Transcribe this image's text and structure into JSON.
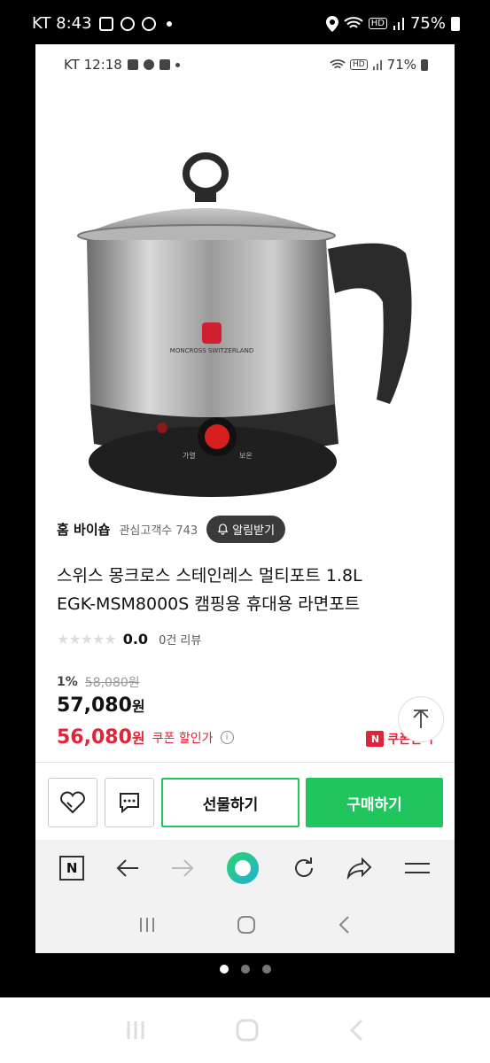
{
  "outer_status": {
    "carrier_time": "KT 8:43",
    "battery": "75%"
  },
  "inner_status": {
    "carrier_time": "KT 12:18",
    "battery": "71%"
  },
  "product_image": {
    "brand_text": "MONCROSS SWITZERLAND",
    "dial_left": "가열",
    "dial_right": "보온"
  },
  "shop": {
    "name": "홈 바이숍",
    "fans_label": "관심고객수 743",
    "alarm_button": "알림받기"
  },
  "product": {
    "title_line1": "스위스 몽크로스 스테인레스 멀티포트 1.8L",
    "title_line2": "EGK-MSM8000S 캠핑용 휴대용 라면포트",
    "stars": "★★★★★",
    "rating": "0.0",
    "review_count": "0건 리뷰",
    "discount_pct": "1%",
    "original_price": "58,080원",
    "price_value": "57,080",
    "price_unit": "원",
    "coupon_price_value": "56,080",
    "coupon_price_unit": "원",
    "coupon_label": "쿠폰 할인가",
    "coupon_info": "i",
    "coupon_get_badge": "N",
    "coupon_get_label": "쿠폰받기"
  },
  "actions": {
    "gift_label": "선물하기",
    "buy_label": "구매하기"
  },
  "browser": {
    "n_label": "N"
  },
  "colors": {
    "accent_green": "#21c55d",
    "coupon_red": "#e0243a"
  }
}
